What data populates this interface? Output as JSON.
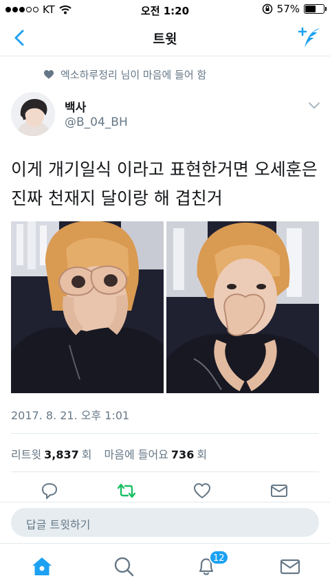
{
  "status_bar": {
    "carrier": "KT",
    "time": "오전 1:20",
    "battery_text": "57%",
    "battery_level": 0.57
  },
  "nav": {
    "title": "트윗",
    "accent": "#1da1f2"
  },
  "context": {
    "text": "엑소하루정리 님이 마음에 들어 함"
  },
  "tweet": {
    "name": "백사",
    "handle": "@B_04_BH",
    "text": "이게 개기일식 이라고 표현한거면 오세훈은 진짜 천재지 달이랑 해 겹친거",
    "timestamp": "2017. 8. 21. 오후 1:01",
    "photo_count": 2
  },
  "stats": {
    "retweet_label": "리트윗",
    "retweet_count": "3,837",
    "retweet_unit": "회",
    "like_label": "마음에 들어요",
    "like_count": "736",
    "like_unit": "회"
  },
  "reply": {
    "placeholder": "답글 트윗하기"
  },
  "tabbar": {
    "notifications_badge": "12",
    "icons": [
      "home-icon",
      "search-icon",
      "bell-icon",
      "mail-icon"
    ]
  }
}
